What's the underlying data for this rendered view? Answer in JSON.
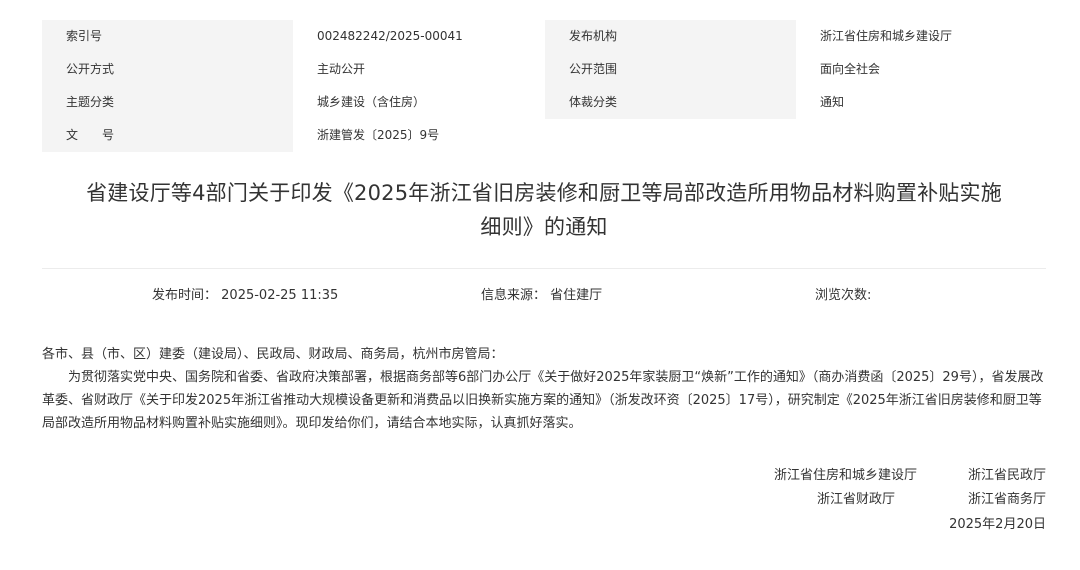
{
  "meta": {
    "rows": [
      {
        "k1": "索引号",
        "v1": "002482242/2025-00041",
        "k2": "发布机构",
        "v2": "浙江省住房和城乡建设厅"
      },
      {
        "k1": "公开方式",
        "v1": "主动公开",
        "k2": "公开范围",
        "v2": "面向全社会"
      },
      {
        "k1": "主题分类",
        "v1": "城乡建设（含住房）",
        "k2": "体裁分类",
        "v2": "通知"
      },
      {
        "k1": "文　　号",
        "v1": "浙建管发〔2025〕9号"
      }
    ]
  },
  "article": {
    "title_line1": "省建设厅等4部门关于印发《2025年浙江省旧房装修和厨卫等局部改造所用物品材料购置补贴实施",
    "title_line2": "细则》的通知",
    "publish_label": "发布时间：",
    "publish_value": "2025-02-25 11:35",
    "source_label": "信息来源：",
    "source_value": "省住建厅",
    "views_label": "浏览次数:",
    "views_value": "",
    "salutation": "各市、县（市、区）建委（建设局）、民政局、财政局、商务局，杭州市房管局：",
    "body": "为贯彻落实党中央、国务院和省委、省政府决策部署，根据商务部等6部门办公厅《关于做好2025年家装厨卫“焕新”工作的通知》（商办消费函〔2025〕29号），省发展改革委、省财政厅《关于印发2025年浙江省推动大规模设备更新和消费品以旧换新实施方案的通知》（浙发改环资〔2025〕17号），研究制定《2025年浙江省旧房装修和厨卫等局部改造所用物品材料购置补贴实施细则》。现印发给你们，请结合本地实际，认真抓好落实。",
    "signatures": [
      "浙江省住房和城乡建设厅",
      "浙江省民政厅",
      "浙江省财政厅",
      "浙江省商务厅"
    ],
    "date": "2025年2月20日"
  }
}
